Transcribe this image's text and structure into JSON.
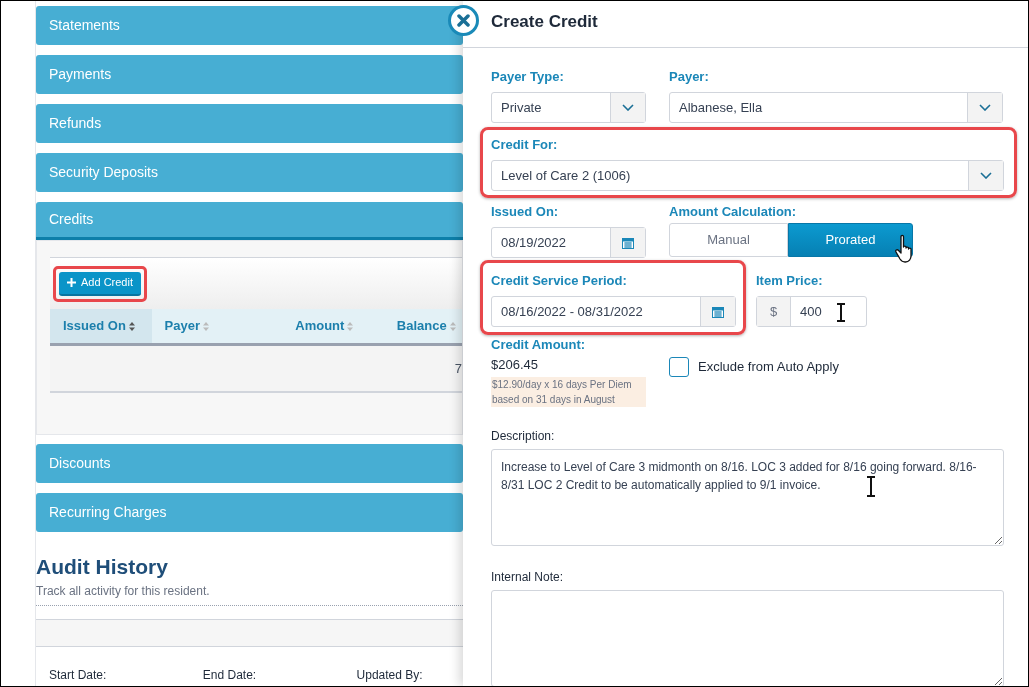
{
  "panels_top": [
    {
      "title": "Statements",
      "expanded": false
    },
    {
      "title": "Payments",
      "expanded": false
    },
    {
      "title": "Refunds",
      "expanded": false
    },
    {
      "title": "Security Deposits",
      "expanded": false
    },
    {
      "title": "Credits",
      "expanded": true
    }
  ],
  "credits": {
    "add_button": {
      "label": "Add Credit",
      "highlighted": true
    },
    "columns": [
      {
        "label": "Issued On",
        "sorted": true
      },
      {
        "label": "Payer",
        "sorted": false
      },
      {
        "label": "Amount",
        "sorted": false
      },
      {
        "label": "Balance",
        "sorted": false
      }
    ],
    "rows": [
      {
        "column_5": "7"
      }
    ]
  },
  "panels_bottom": [
    {
      "title": "Discounts",
      "expanded": false
    },
    {
      "title": "Recurring Charges",
      "expanded": false
    }
  ],
  "audit": {
    "title": "Audit History",
    "subtitle": "Track all activity for this resident.",
    "filters": [
      "Start Date:",
      "End Date:",
      "Updated By:"
    ]
  },
  "drawer": {
    "title": "Create Credit",
    "payer_type": {
      "label": "Payer Type:",
      "value": "Private"
    },
    "payer": {
      "label": "Payer:",
      "value": "Albanese, Ella"
    },
    "credit_for": {
      "label": "Credit For:",
      "value": "Level of Care 2 (1006)",
      "highlighted": true
    },
    "issued_on": {
      "label": "Issued On:",
      "value": "08/19/2022"
    },
    "amount_calculation": {
      "label": "Amount Calculation:",
      "options": [
        {
          "label": "Manual",
          "selected": false
        },
        {
          "label": "Prorated",
          "selected": true
        }
      ]
    },
    "credit_service_period": {
      "label": "Credit Service Period:",
      "value": "08/16/2022 - 08/31/2022",
      "highlighted": true
    },
    "item_price": {
      "label": "Item Price:",
      "prefix": "$",
      "value": "400"
    },
    "credit_amount": {
      "label": "Credit Amount:",
      "value": "$206.45",
      "note": "$12.90/day x 16 days Per Diem based on 31 days in August"
    },
    "exclude_auto_apply": {
      "label": "Exclude from Auto Apply",
      "checked": false
    },
    "description": {
      "label": "Description:",
      "value": "Increase to Level of Care 3 midmonth on 8/16. LOC 3 added for 8/16 going forward. 8/16-8/31 LOC 2 Credit to be automatically applied to 9/1 invoice."
    },
    "internal_note": {
      "label": "Internal Note:"
    }
  }
}
